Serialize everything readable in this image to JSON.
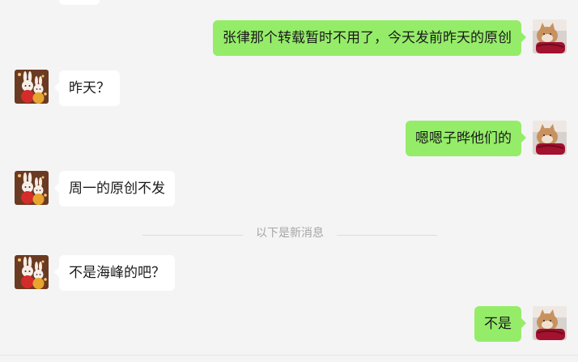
{
  "chat": {
    "messages": [
      {
        "side": "out",
        "text": "张律那个转载暂时不用了，今天发前昨天的原创"
      },
      {
        "side": "in",
        "text": "昨天？"
      },
      {
        "side": "out",
        "text": "嗯嗯子晔他们的"
      },
      {
        "side": "in",
        "text": "周一的原创不发"
      },
      {
        "side": "in",
        "text": "不是海峰的吧？"
      },
      {
        "side": "out",
        "text": "不是"
      }
    ],
    "divider_label": "以下是新消息"
  },
  "avatars": {
    "contact": "bunny-couple-avatar",
    "self": "cat-avatar"
  }
}
